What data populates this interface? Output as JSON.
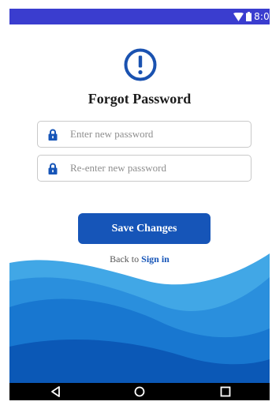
{
  "status_bar": {
    "time": "8:0"
  },
  "screen": {
    "title": "Forgot Password"
  },
  "fields": {
    "new_password_placeholder": "Enter new password",
    "reenter_password_placeholder": "Re-enter new password"
  },
  "actions": {
    "save_label": "Save Changes",
    "back_prefix": "Back to",
    "sign_in_label": "Sign in"
  },
  "icons": {
    "alert": "alert-circle-icon",
    "lock": "lock-icon",
    "wifi": "wifi-icon",
    "battery": "battery-icon",
    "back": "back-triangle-icon",
    "home": "home-circle-icon",
    "recents": "recents-square-icon"
  },
  "colors": {
    "status_bar": "#3a3dcf",
    "accent": "#1655b8",
    "wave_light": "#41a7e6",
    "wave_mid": "#1877d0",
    "wave_dark": "#0b58b6",
    "nav_bar": "#000000"
  }
}
